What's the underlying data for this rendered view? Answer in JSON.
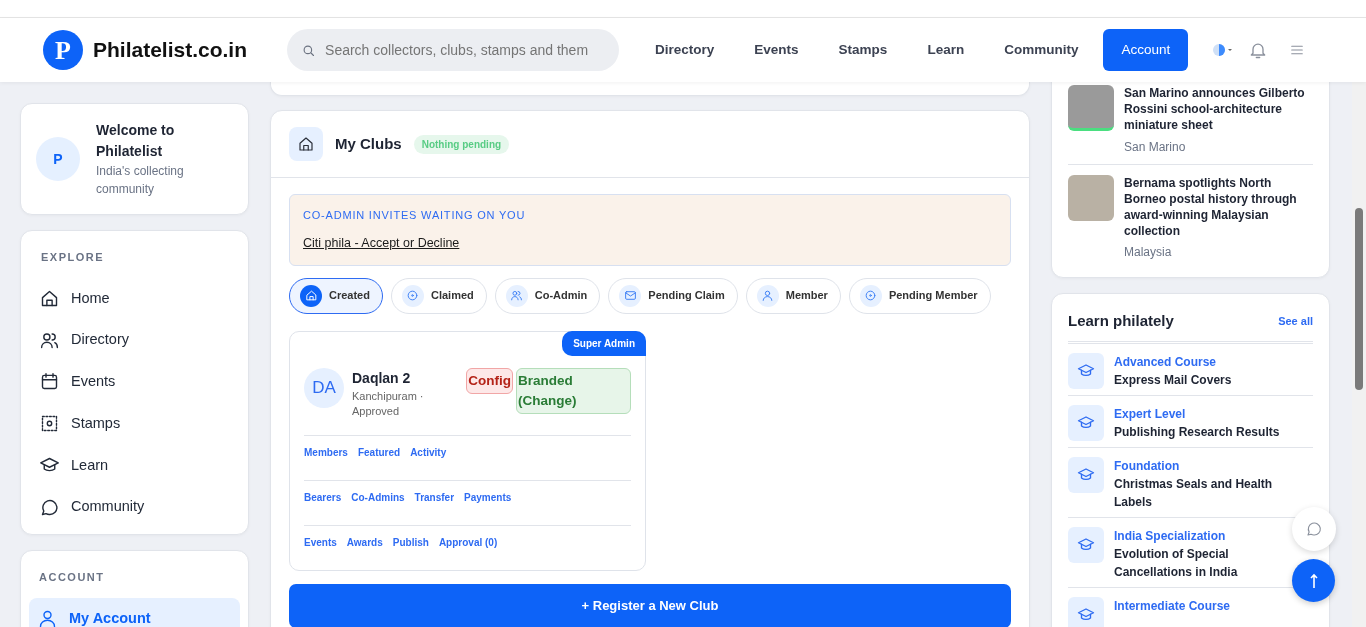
{
  "brand": {
    "logo_letter": "P",
    "name": "Philatelist.co.in"
  },
  "search": {
    "placeholder": "Search collectors, clubs, stamps and them"
  },
  "nav": [
    {
      "label": "Directory"
    },
    {
      "label": "Events"
    },
    {
      "label": "Stamps"
    },
    {
      "label": "Learn"
    },
    {
      "label": "Community"
    }
  ],
  "account_button": "Account",
  "welcome": {
    "avatar": "P",
    "title": "Welcome to Philatelist",
    "subtitle": "India's collecting community"
  },
  "explore": {
    "heading": "EXPLORE",
    "items": [
      {
        "label": "Home",
        "selected": false
      },
      {
        "label": "Directory",
        "selected": false
      },
      {
        "label": "Events",
        "selected": false
      },
      {
        "label": "Stamps",
        "selected": false
      },
      {
        "label": "Learn",
        "selected": false
      },
      {
        "label": "Community",
        "selected": false
      }
    ]
  },
  "account": {
    "heading": "ACCOUNT",
    "items": [
      {
        "label": "My Account",
        "selected": true
      }
    ]
  },
  "clubs": {
    "title": "My Clubs",
    "status": "Nothing pending",
    "invites": {
      "heading": "CO-ADMIN INVITES WAITING ON YOU",
      "link": "Citi phila - Accept or Decline"
    },
    "filters": [
      {
        "label": "Created",
        "selected": true
      },
      {
        "label": "Claimed",
        "selected": false
      },
      {
        "label": "Co-Admin",
        "selected": false
      },
      {
        "label": "Pending Claim",
        "selected": false
      },
      {
        "label": "Member",
        "selected": false
      },
      {
        "label": "Pending Member",
        "selected": false
      }
    ],
    "cards": [
      {
        "role": "Super Admin",
        "initials": "DA",
        "name": "Daqlan 2",
        "meta": "Kanchipuram · Approved",
        "tags": [
          {
            "label": "Config",
            "kind": "danger"
          },
          {
            "label": "Branded (Change)",
            "kind": "success"
          }
        ],
        "link_rows": [
          [
            "Members",
            "Featured",
            "Activity"
          ],
          [
            "Bearers",
            "Co-Admins",
            "Transfer",
            "Payments"
          ],
          [
            "Events",
            "Awards",
            "Publish",
            "Approval (0)"
          ]
        ]
      }
    ],
    "register": "+ Register a New Club"
  },
  "news": [
    {
      "title": "San Marino announces Gilberto Rossini school-architecture miniature sheet",
      "place": "San Marino"
    },
    {
      "title": "Bernama spotlights North Borneo postal history through award-winning Malaysian collection",
      "place": "Malaysia"
    }
  ],
  "learn": {
    "title": "Learn philately",
    "see_all": "See all",
    "items": [
      {
        "level": "Advanced Course",
        "topic": "Express Mail Covers"
      },
      {
        "level": "Expert Level",
        "topic": "Publishing Research Results"
      },
      {
        "level": "Foundation",
        "topic": "Christmas Seals and Health Labels"
      },
      {
        "level": "India Specialization",
        "topic": "Evolution of Special Cancellations in India"
      },
      {
        "level": "Intermediate Course"
      }
    ]
  }
}
